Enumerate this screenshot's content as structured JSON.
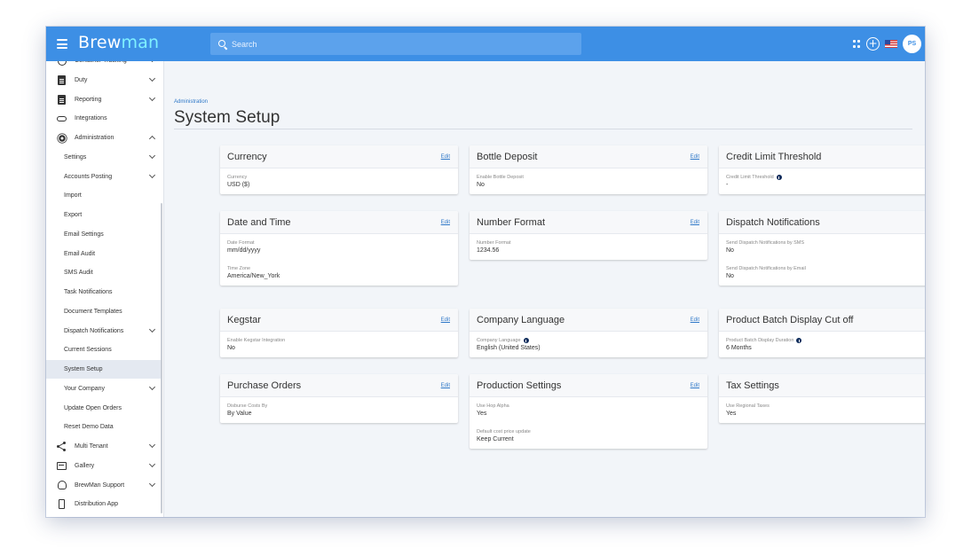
{
  "app": {
    "logo_prefix": "Brew",
    "logo_suffix": "man"
  },
  "search": {
    "placeholder": "Search"
  },
  "user": {
    "initials": "PS"
  },
  "icons": {
    "topbar": [
      "menu-icon",
      "search-icon",
      "grid-icon",
      "add-icon",
      "us-flag-icon",
      "avatar"
    ],
    "help": "help-icon"
  },
  "colors": {
    "topbar": "#3d8fe5",
    "link": "#2f78c8",
    "info": "#0f2d5c",
    "logo_accent": "#7ff0ff"
  },
  "sidebar": {
    "items": [
      {
        "label": "Container Tracking",
        "icon": "tracking-icon",
        "expandable": true
      },
      {
        "label": "Duty",
        "icon": "document-icon",
        "expandable": true
      },
      {
        "label": "Reporting",
        "icon": "document-icon",
        "expandable": true
      },
      {
        "label": "Integrations",
        "icon": "link-icon",
        "expandable": false
      },
      {
        "label": "Administration",
        "icon": "gear-icon",
        "expandable": true,
        "expanded": true
      },
      {
        "label": "Settings",
        "sub": true,
        "expandable": true
      },
      {
        "label": "Accounts Posting",
        "sub": true,
        "expandable": true
      },
      {
        "label": "Import",
        "sub": true
      },
      {
        "label": "Export",
        "sub": true
      },
      {
        "label": "Email Settings",
        "sub": true
      },
      {
        "label": "Email Audit",
        "sub": true
      },
      {
        "label": "SMS Audit",
        "sub": true
      },
      {
        "label": "Task Notifications",
        "sub": true
      },
      {
        "label": "Document Templates",
        "sub": true
      },
      {
        "label": "Dispatch Notifications",
        "sub": true,
        "expandable": true
      },
      {
        "label": "Current Sessions",
        "sub": true
      },
      {
        "label": "System Setup",
        "sub": true,
        "active": true
      },
      {
        "label": "Your Company",
        "sub": true,
        "expandable": true
      },
      {
        "label": "Update Open Orders",
        "sub": true
      },
      {
        "label": "Reset Demo Data",
        "sub": true
      },
      {
        "label": "Multi Tenant",
        "icon": "share-icon",
        "expandable": true
      },
      {
        "label": "Gallery",
        "icon": "gallery-icon",
        "expandable": true
      },
      {
        "label": "BrewMan Support",
        "icon": "support-icon",
        "expandable": true
      },
      {
        "label": "Distribution App",
        "icon": "phone-icon",
        "expandable": false
      }
    ]
  },
  "main": {
    "breadcrumb": "Administration",
    "title": "System Setup",
    "edit_label": "Edit",
    "cards": [
      {
        "title": "Currency",
        "fields": [
          {
            "label": "Currency",
            "value": "USD ($)"
          }
        ]
      },
      {
        "title": "Bottle Deposit",
        "fields": [
          {
            "label": "Enable Bottle Deposit",
            "value": "No"
          }
        ]
      },
      {
        "title": "Credit Limit Threshold",
        "fields": [
          {
            "label": "Credit Limit Threshold",
            "value": "-",
            "info": true
          }
        ]
      },
      {
        "title": "Date and Time",
        "fields": [
          {
            "label": "Date Format",
            "value": "mm/dd/yyyy"
          },
          {
            "label": "Time Zone",
            "value": "America/New_York"
          }
        ]
      },
      {
        "title": "Number Format",
        "fields": [
          {
            "label": "Number Format",
            "value": "1234.56"
          }
        ]
      },
      {
        "title": "Dispatch Notifications",
        "fields": [
          {
            "label": "Send Dispatch Notifications by SMS",
            "value": "No"
          },
          {
            "label": "Send Dispatch Notifications by Email",
            "value": "No"
          }
        ]
      },
      {
        "title": "Kegstar",
        "fields": [
          {
            "label": "Enable Kegstar Integration",
            "value": "No"
          }
        ]
      },
      {
        "title": "Company Language",
        "fields": [
          {
            "label": "Company Language",
            "value": "English (United States)",
            "info": true
          }
        ]
      },
      {
        "title": "Product Batch Display Cut off",
        "fields": [
          {
            "label": "Product Batch Display Duration",
            "value": "6  Months",
            "info": true
          }
        ]
      },
      {
        "title": "Purchase Orders",
        "fields": [
          {
            "label": "Disburse Costs By",
            "value": "By Value"
          }
        ]
      },
      {
        "title": "Production Settings",
        "fields": [
          {
            "label": "Use Hop Alpha",
            "value": "Yes"
          },
          {
            "label": "Default cost price update",
            "value": "Keep Current"
          }
        ]
      },
      {
        "title": "Tax Settings",
        "fields": [
          {
            "label": "Use Regional Taxes",
            "value": "Yes"
          }
        ]
      }
    ]
  }
}
